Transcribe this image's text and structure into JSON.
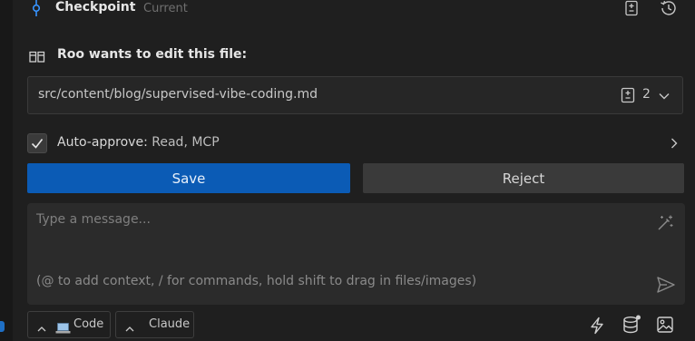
{
  "checkpoint": {
    "title": "Checkpoint",
    "status": "Current"
  },
  "edit_request": {
    "title": "Roo wants to edit this file:"
  },
  "file": {
    "path": "src/content/blog/supervised-vibe-coding.md",
    "change_count": "2"
  },
  "auto_approve": {
    "label": "Auto-approve:",
    "value": "Read, MCP",
    "checked": true
  },
  "actions": {
    "save_label": "Save",
    "reject_label": "Reject"
  },
  "chat": {
    "placeholder": "Type a message...",
    "hint": "(@ to add context, / for commands, hold shift to drag in files/images)"
  },
  "footer": {
    "mode_label": "Code",
    "model_label": "Claude"
  },
  "icons": {
    "checkpoint": "git-commit-icon",
    "checkpoint_diff": "diff-icon",
    "checkpoint_restore": "history-icon",
    "edit": "split-view-icon",
    "file_diff": "diff-icon",
    "file_expand": "chevron-down-icon",
    "auto_check": "checkmark-icon",
    "auto_expand": "chevron-right-icon",
    "enhance": "magic-wand-icon",
    "send": "send-icon",
    "mode": "laptop-icon",
    "select_chevron": "chevron-up-icon",
    "bolt": "lightning-icon",
    "database": "database-icon",
    "image": "image-icon"
  },
  "colors": {
    "primary": "#0b5bb5",
    "accent": "#3794ff",
    "background": "#1f1f1f"
  }
}
